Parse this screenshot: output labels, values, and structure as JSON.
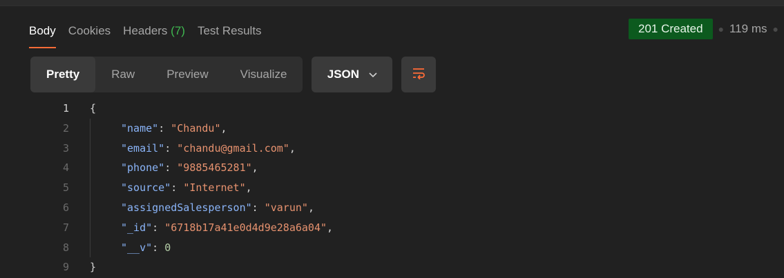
{
  "response_tabs": [
    {
      "label": "Body",
      "active": true
    },
    {
      "label": "Cookies"
    },
    {
      "label": "Headers",
      "count": "(7)"
    },
    {
      "label": "Test Results"
    }
  ],
  "status": {
    "text": "201 Created",
    "time": "119 ms",
    "color": "#0c5a1e"
  },
  "view_modes": [
    "Pretty",
    "Raw",
    "Preview",
    "Visualize"
  ],
  "format": {
    "selected": "JSON"
  },
  "icons": {
    "wrap": "wrap-lines-icon",
    "chevron": "chevron-down-icon"
  },
  "code": {
    "line_numbers": [
      "1",
      "2",
      "3",
      "4",
      "5",
      "6",
      "7",
      "8",
      "9"
    ],
    "open_brace": "{",
    "close_brace": "}",
    "fields": [
      {
        "key": "\"name\"",
        "value": "\"Chandu\"",
        "comma": ","
      },
      {
        "key": "\"email\"",
        "value": "\"chandu@gmail.com\"",
        "comma": ","
      },
      {
        "key": "\"phone\"",
        "value": "\"9885465281\"",
        "comma": ","
      },
      {
        "key": "\"source\"",
        "value": "\"Internet\"",
        "comma": ","
      },
      {
        "key": "\"assignedSalesperson\"",
        "value": "\"varun\"",
        "comma": ","
      },
      {
        "key": "\"_id\"",
        "value": "\"6718b17a41e0d4d9e28a6a04\"",
        "comma": ","
      },
      {
        "key": "\"__v\"",
        "value": "0",
        "comma": ""
      }
    ]
  },
  "accent_color": "#ff6c37"
}
